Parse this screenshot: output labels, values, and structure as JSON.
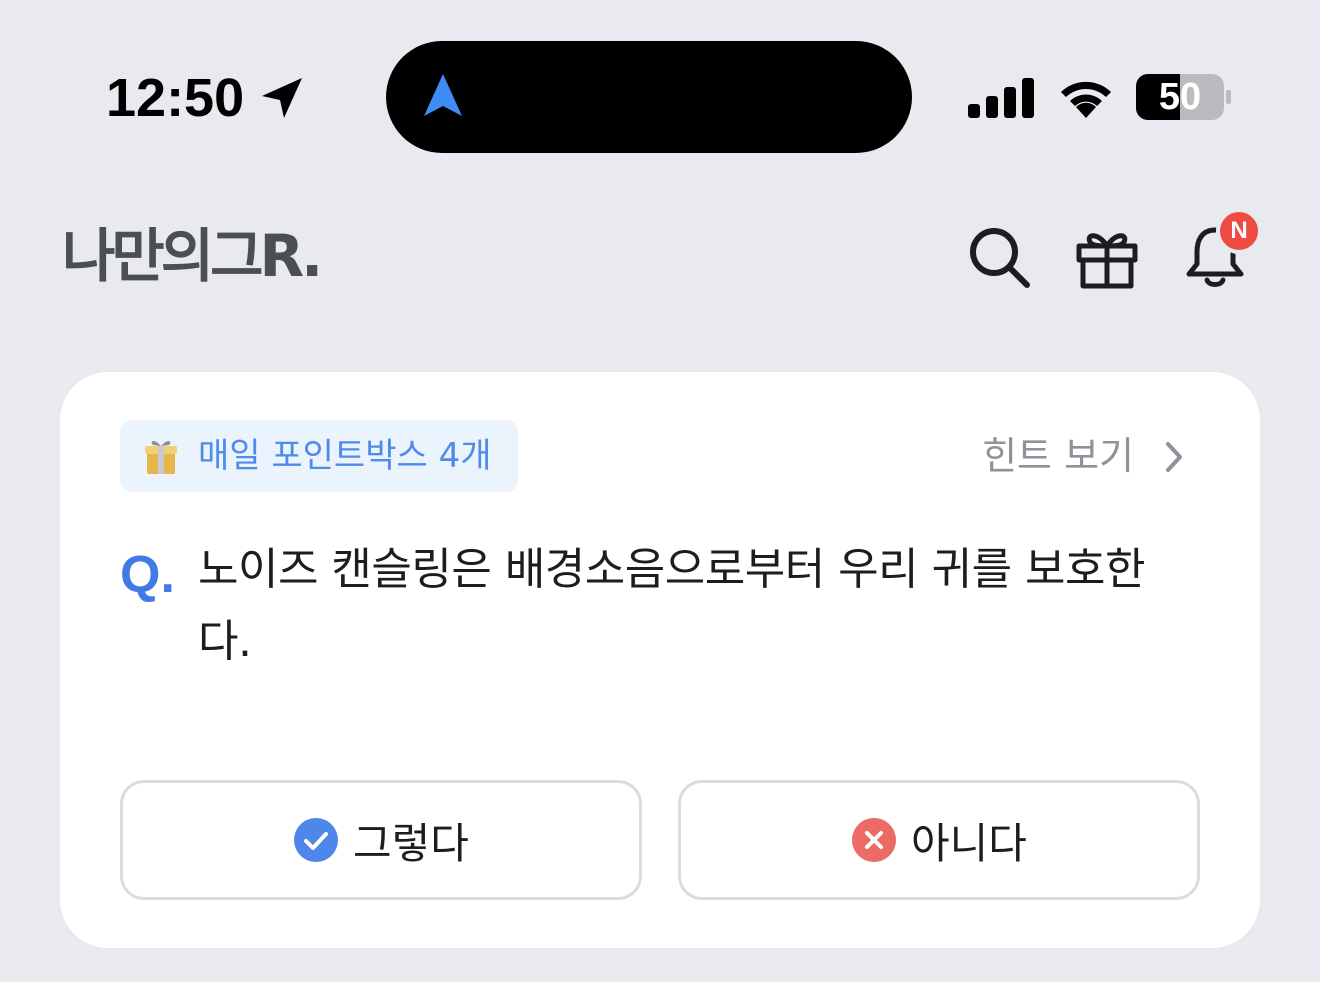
{
  "status_bar": {
    "time": "12:50",
    "battery_level": "50",
    "icons": [
      "location-arrow-icon",
      "navigation-arrow-icon",
      "signal-icon",
      "wifi-icon",
      "battery-icon"
    ]
  },
  "header": {
    "logo_text": "나만의그R.",
    "icons": [
      "search-icon",
      "gift-icon",
      "bell-icon"
    ],
    "notification_badge": "N"
  },
  "card": {
    "point_box_label": "매일 포인트박스 4개",
    "point_box_icon": "gift-box-icon",
    "hint_label": "힌트 보기",
    "question_marker": "Q.",
    "question_text": "노이즈 캔슬링은 배경소음으로부터 우리 귀를 보호한다.",
    "answers": [
      {
        "label": "그렇다",
        "icon": "check-circle-icon"
      },
      {
        "label": "아니다",
        "icon": "x-circle-icon"
      }
    ]
  },
  "colors": {
    "background": "#e9eaef",
    "accent_blue": "#3e7be7",
    "check_blue": "#4f86ea",
    "badge_red": "#ef4b44",
    "x_red": "#ec6b67",
    "chip_bg": "#ebf3fd"
  }
}
